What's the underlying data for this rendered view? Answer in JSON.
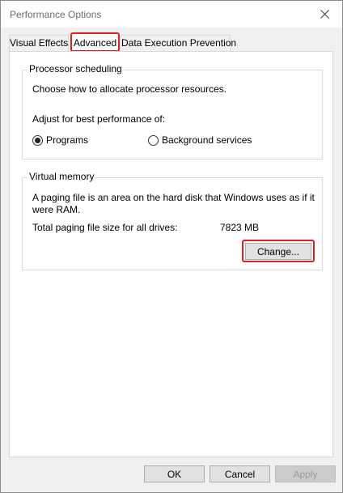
{
  "window": {
    "title": "Performance Options",
    "close_glyph": "×"
  },
  "tabs": [
    {
      "label": "Visual Effects",
      "active": false
    },
    {
      "label": "Advanced",
      "active": true
    },
    {
      "label": "Data Execution Prevention",
      "active": false
    }
  ],
  "processor_scheduling": {
    "title": "Processor scheduling",
    "description": "Choose how to allocate processor resources.",
    "adjust_label": "Adjust for best performance of:",
    "options": [
      {
        "label": "Programs",
        "selected": true
      },
      {
        "label": "Background services",
        "selected": false
      }
    ]
  },
  "virtual_memory": {
    "title": "Virtual memory",
    "description_line1": "A paging file is an area on the hard disk that Windows uses as if it",
    "description_line2": "were RAM.",
    "total_label": "Total paging file size for all drives:",
    "total_value": "7823 MB",
    "change_button": "Change..."
  },
  "footer": {
    "ok": "OK",
    "cancel": "Cancel",
    "apply": "Apply"
  },
  "colors": {
    "highlight": "#e02020"
  }
}
